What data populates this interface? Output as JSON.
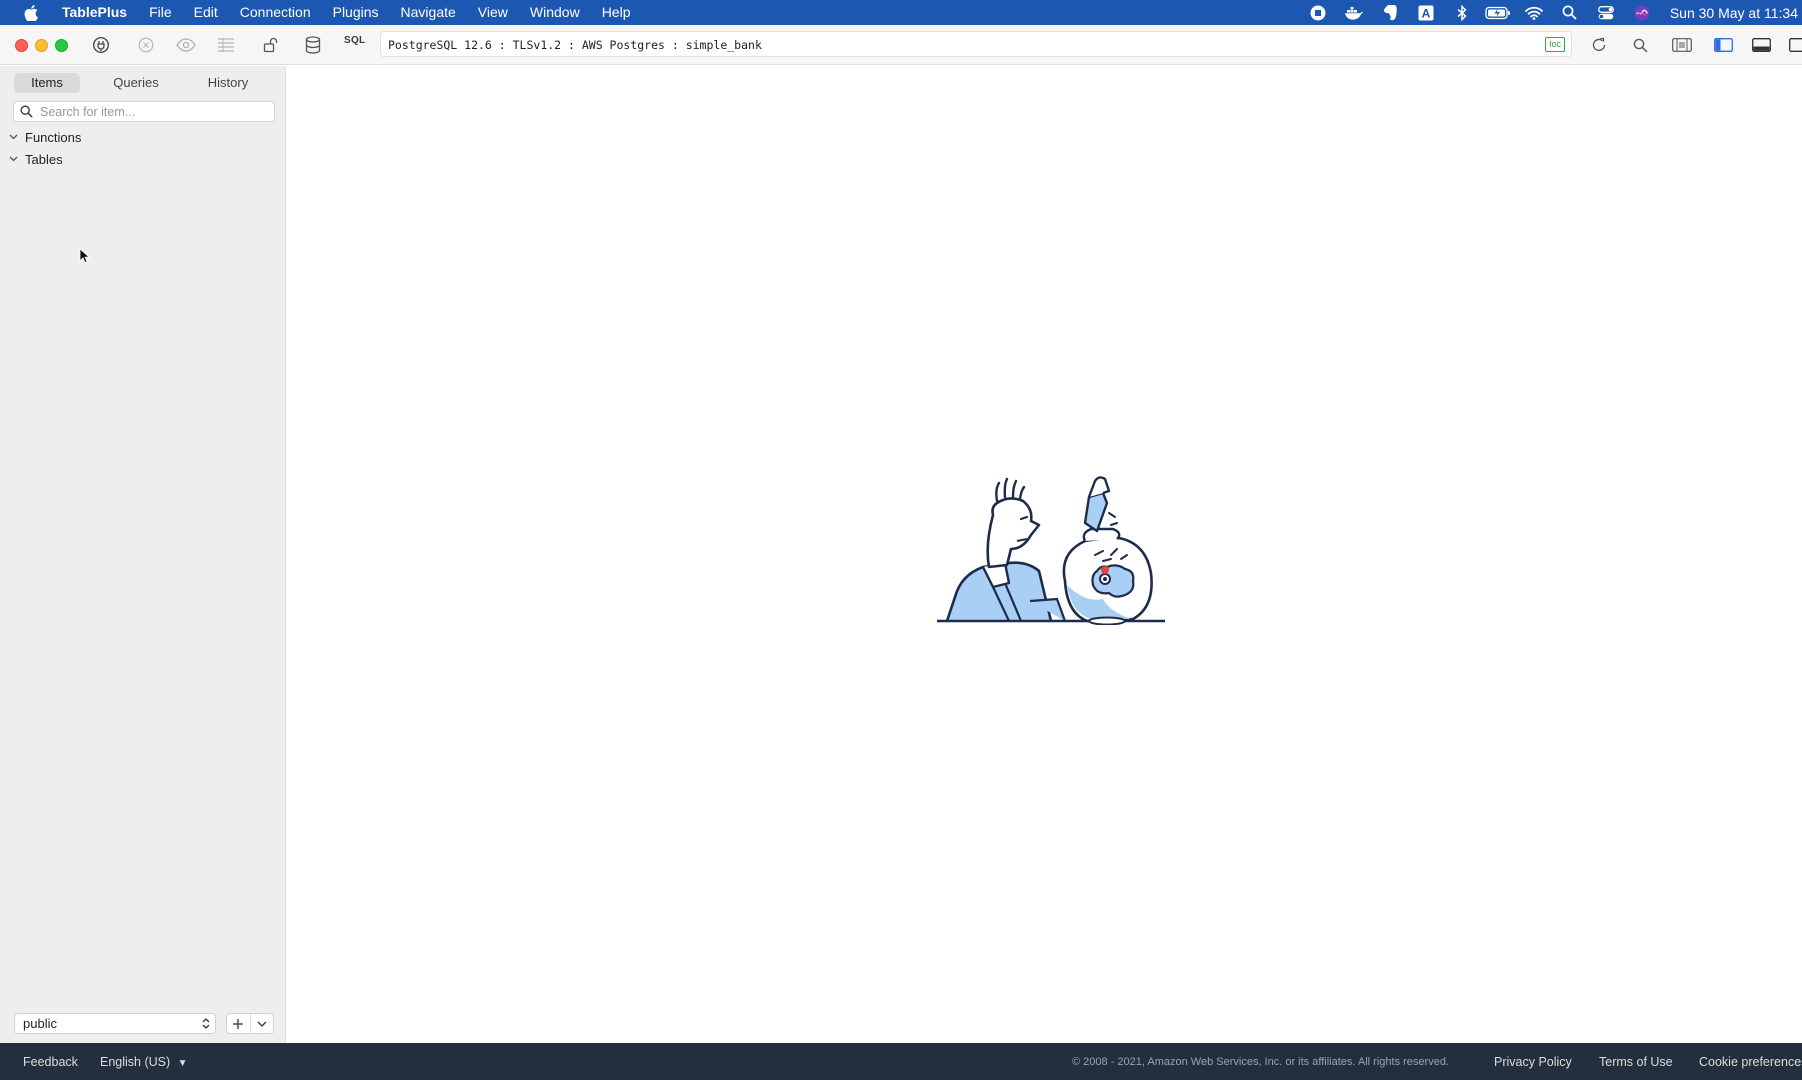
{
  "menubar": {
    "app_name": "TablePlus",
    "items": [
      "File",
      "Edit",
      "Connection",
      "Plugins",
      "Navigate",
      "View",
      "Window",
      "Help"
    ],
    "clock": "Sun 30 May at  11:34"
  },
  "toolbar": {
    "sql_label": "SQL",
    "connection_info": "PostgreSQL 12.6 : TLSv1.2 : AWS Postgres : simple_bank",
    "loc_badge": "loc",
    "badge_color": "#3aa34a"
  },
  "sidebar": {
    "tabs": [
      {
        "label": "Items",
        "active": true
      },
      {
        "label": "Queries",
        "active": false
      },
      {
        "label": "History",
        "active": false
      }
    ],
    "search_placeholder": "Search for item...",
    "tree": [
      {
        "label": "Functions",
        "expanded": true
      },
      {
        "label": "Tables",
        "expanded": true
      }
    ],
    "schema": "public"
  },
  "footer": {
    "feedback": "Feedback",
    "language": "English (US)",
    "copyright": "© 2008 - 2021, Amazon Web Services, Inc. or its affiliates. All rights reserved.",
    "privacy": "Privacy Policy",
    "terms": "Terms of Use",
    "cookies": "Cookie preferences"
  },
  "colors": {
    "menubar": "#1c57b2",
    "footer": "#232f3e",
    "illustration_fill": "#a9cff5",
    "illustration_stroke": "#1f2b4a"
  }
}
